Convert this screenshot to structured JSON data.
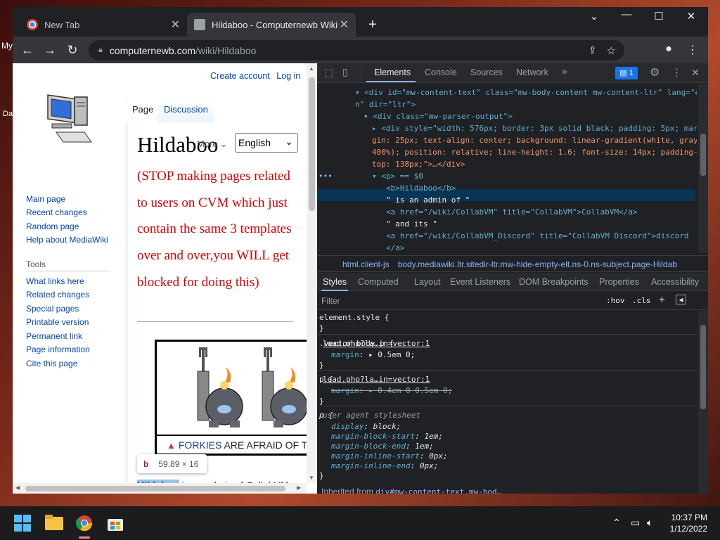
{
  "desktop": {
    "label_my": "My",
    "label_da": "Da"
  },
  "browser": {
    "tabs": [
      {
        "title": "New Tab"
      },
      {
        "title": "Hildaboo - Computernewb Wiki"
      }
    ],
    "url_host": "computernewb.com",
    "url_path": "/wiki/Hildaboo"
  },
  "wiki": {
    "personal": {
      "create_account": "Create account",
      "login": "Log in"
    },
    "page_tabs": {
      "page": "Page",
      "discussion": "Discussion"
    },
    "more": "More",
    "language": "English",
    "title": "Hildaboo",
    "notice": "(STOP making pages related to users on CVM which just contain the same 3 templates over and over,you WILL get blocked for doing this)",
    "nav": [
      "Main page",
      "Recent changes",
      "Random page",
      "Help about MediaWiki"
    ],
    "tools_heading": "Tools",
    "tools": [
      "What links here",
      "Related changes",
      "Special pages",
      "Printable version",
      "Permanent link",
      "Page information",
      "Cite this page"
    ],
    "banner_caption": {
      "highlight": "FORKIES",
      "rest": " ARE AFRAID OF T"
    },
    "tooltip": {
      "tag": "b",
      "size": "59.89 × 16"
    },
    "intro": {
      "bold": "Hildaboo",
      "mid": " is an admin of ",
      "link": "CollabVM"
    }
  },
  "devtools": {
    "tabs": [
      "Elements",
      "Console",
      "Sources",
      "Network"
    ],
    "badge": "1",
    "dom_lines": [
      "<div id=\"mw-content-text\" class=\"mw-body-content mw-content-ltr\" lang=\"e",
      "n\" dir=\"ltr\">",
      "<div class=\"mw-parser-output\">",
      "<div style=\"width: 576px; border: 3px solid black; padding: 5px; mar",
      "gin: 25px; text-align: center; background: linear-gradient(white, gray",
      "400%); position: relative; line-height: 1.6; font-size: 14px; padding-",
      "top: 138px;\">…</div>",
      "<p> == $0",
      "<b>Hildaboo</b>",
      "\" is an admin of \"",
      "<a href=\"/wiki/CollabVM\" title=\"CollabVM\">CollabVM</a>",
      "\" and its \"",
      "<a href=\"/wiki/CollabVM_Discord\" title=\"CollabVM Discord\">discord",
      "</a>"
    ],
    "breadcrumbs": [
      "html.client-js",
      "body.mediawiki.ltr.sitedir-ltr.mw-hide-empty-elt.ns-0.ns-subject.page-Hildab"
    ],
    "styles_tabs": [
      "Styles",
      "Computed",
      "Layout",
      "Event Listeners",
      "DOM Breakpoints",
      "Properties",
      "Accessibility"
    ],
    "filter_placeholder": "Filter",
    "filter_tools": [
      ":hov",
      ".cls",
      "+"
    ],
    "rules": [
      {
        "selector": "element.style {",
        "source": "",
        "decls": [],
        "close": "}"
      },
      {
        "selector": ".vector-body p {",
        "source": "load.php?la…in=vector:1",
        "decls": [
          {
            "p": "margin",
            "v": "▸ 0.5em 0;"
          }
        ],
        "close": "}"
      },
      {
        "selector": "p {",
        "source": "load.php?la…in=vector:1",
        "decls": [
          {
            "p": "margin",
            "v": "▸ 0.4em 0 0.5em 0;"
          }
        ],
        "close": "}"
      },
      {
        "selector": "p {",
        "source": "user agent stylesheet",
        "decls": [
          {
            "p": "display",
            "v": "block;"
          },
          {
            "p": "margin-block-start",
            "v": "1em;"
          },
          {
            "p": "margin-block-end",
            "v": "1em;"
          },
          {
            "p": "margin-inline-start",
            "v": "0px;"
          },
          {
            "p": "margin-inline-end",
            "v": "0px;"
          }
        ],
        "close": "}"
      }
    ],
    "inherited_label": "Inherited from",
    "inherited_from": "div#mw-content-text.mw-bod…"
  },
  "taskbar": {
    "time": "10:37 PM",
    "date": "1/12/2022"
  }
}
